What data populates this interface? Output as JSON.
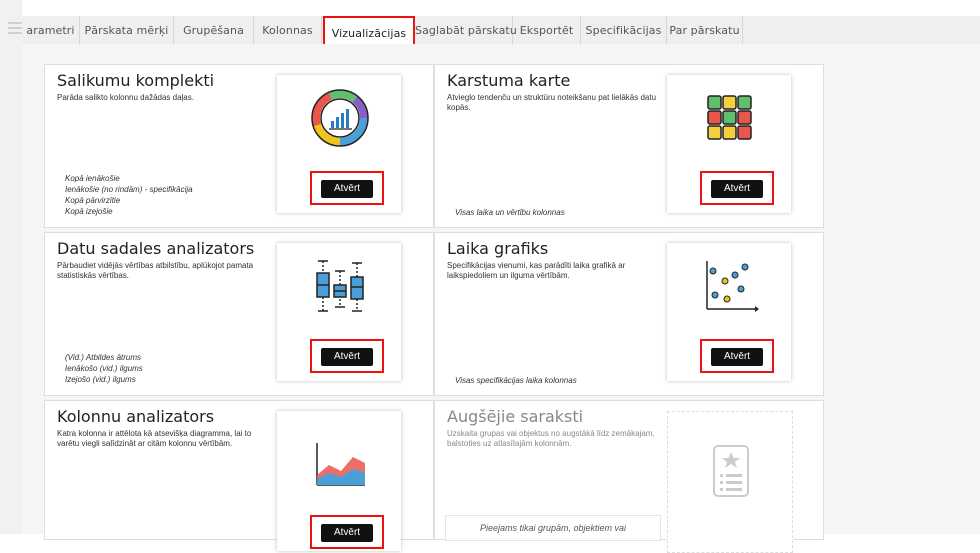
{
  "tabs": [
    {
      "label": "arametri"
    },
    {
      "label": "Pārskata mērķi"
    },
    {
      "label": "Grupēšana"
    },
    {
      "label": "Kolonnas"
    },
    {
      "label": "Vizualizācijas"
    },
    {
      "label": "Saglabāt pārskatu"
    },
    {
      "label": "Eksportēt"
    },
    {
      "label": "Specifikācijas"
    },
    {
      "label": "Par pārskatu"
    }
  ],
  "cards": [
    {
      "title": "Salikumu komplekti",
      "desc": "Parāda salikto kolonnu dažādas daļas.",
      "items": [
        "Kopā ienākošie",
        "Ienākošie (no rindām) - specifikācija",
        "Kopā pārvirzītie",
        "Kopā izejošie"
      ],
      "button": "Atvērt",
      "icon": "donut-chart-icon"
    },
    {
      "title": "Karstuma karte",
      "desc": "Atvieglo tendenču un struktūru noteikšanu pat lielākās datu kopās.",
      "footer": "Visas laika un vērtību kolonnas",
      "button": "Atvērt",
      "icon": "heatmap-grid-icon"
    },
    {
      "title": "Datu sadales analizators",
      "desc": "Pārbaudiet vidējās vērtības atbilstību, aplūkojot pamata statistiskās vērtības.",
      "items": [
        "(Vid.) Atbildes ātrums",
        "Ienākošo (vid.) ilgums",
        "Izejošo (vid.) ilgums"
      ],
      "button": "Atvērt",
      "icon": "box-plot-icon"
    },
    {
      "title": "Laika grafiks",
      "desc": "Specifikācijas vienumi, kas parādīti laika grafikā ar laikspiedoliem un ilguma vērtībām.",
      "footer": "Visas specifikācijas laika kolonnas",
      "button": "Atvērt",
      "icon": "scatter-plot-icon"
    },
    {
      "title": "Kolonnu analizators",
      "desc": "Katra kolonna ir attēlota kā atsevišķa diagramma, lai to varētu viegli salīdzināt ar citām kolonnu vērtībām.",
      "button": "Atvērt",
      "icon": "area-chart-icon"
    },
    {
      "title": "Augšējie saraksti",
      "desc": "Uzskaita grupas vai objektus no augstākā līdz zemākajam, balstoties uz atlasītajām kolonnām.",
      "note": "Pieejams tikai grupām, objektiem vai",
      "icon": "ranked-list-icon"
    }
  ],
  "colors": {
    "highlight": "#ee1111",
    "button_bg": "#111111"
  }
}
